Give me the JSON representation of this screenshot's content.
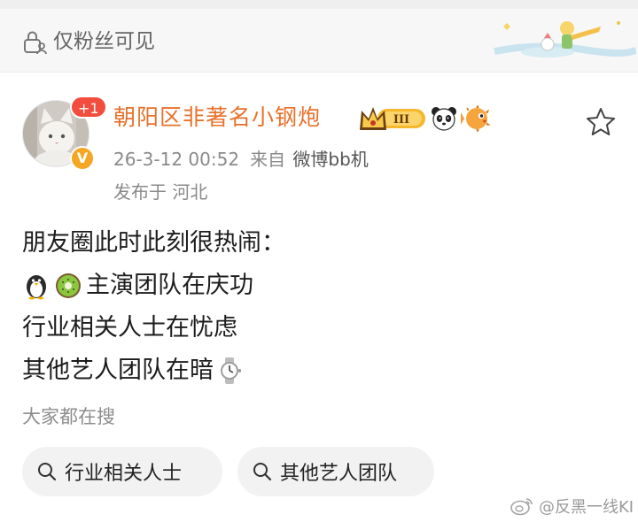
{
  "visibility": {
    "label": "仅粉丝可见",
    "icon": "lock-person-icon"
  },
  "post": {
    "author": {
      "name": "朝阳区非著名小钢炮",
      "notification_count": "+1",
      "verified_mark": "V",
      "level_badge": "III"
    },
    "timestamp": "26-3-12 00:52",
    "source_prefix": "来自",
    "source": "微博bb机",
    "location": "发布于 河北",
    "lines": [
      {
        "text": "朋友圈此时此刻很热闹："
      },
      {
        "emojis": [
          "penguin-emoji",
          "kiwi-emoji"
        ],
        "text": "主演团队在庆功"
      },
      {
        "text": "行业相关人士在忧虑"
      },
      {
        "text": "其他艺人团队在暗",
        "trailing_emoji": "watch-emoji"
      }
    ]
  },
  "search": {
    "heading": "大家都在搜",
    "chips": [
      "行业相关人士",
      "其他艺人团队"
    ]
  },
  "watermark": {
    "text": "@反黑一线KI"
  },
  "colors": {
    "username": "#e8712b",
    "meta": "#8a8a8a",
    "chip_bg": "#f2f2f2",
    "badge_red": "#f24d3e",
    "verified_orange": "#f5a623"
  }
}
